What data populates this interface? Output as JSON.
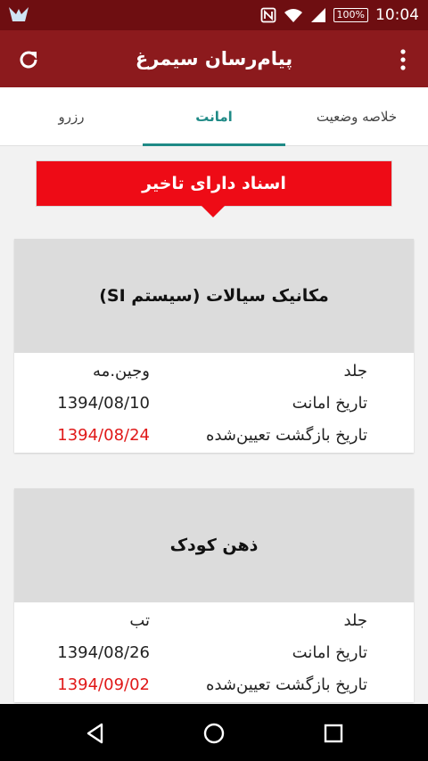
{
  "status_bar": {
    "battery": "100%",
    "time": "10:04"
  },
  "app_bar": {
    "title": "پیام‌رسان سیمرغ",
    "icons": {
      "left": "refresh-icon",
      "right": "overflow-menu-icon"
    }
  },
  "tabs": [
    {
      "label": "خلاصه وضعیت",
      "active": false
    },
    {
      "label": "امانت",
      "active": true
    },
    {
      "label": "رزرو",
      "active": false
    }
  ],
  "banner": {
    "text": "اسناد دارای تاخیر"
  },
  "cards": [
    {
      "title": "مکانیک سیالات (سیستم SI)",
      "rows": [
        {
          "label": "جلد",
          "value": "وجین.مه"
        },
        {
          "label": "تاریخ امانت",
          "value": "1394/08/10"
        },
        {
          "label": "تاریخ بازگشت تعیین‌شده",
          "value": "1394/08/24"
        }
      ]
    },
    {
      "title": "ذهن کودک",
      "rows": [
        {
          "label": "جلد",
          "value": "تب"
        },
        {
          "label": "تاریخ امانت",
          "value": "1394/08/26"
        },
        {
          "label": "تاریخ بازگشت تعیین‌شده",
          "value": "1394/09/02"
        }
      ]
    }
  ],
  "colors": {
    "status_bar": "#6e0e11",
    "app_bar": "#8c1a1d",
    "tab_accent": "#1f8a86",
    "banner": "#ee0b16",
    "late_date": "#e01818"
  },
  "nav_bar": {
    "icons": [
      "back-icon",
      "home-icon",
      "recents-icon"
    ]
  }
}
